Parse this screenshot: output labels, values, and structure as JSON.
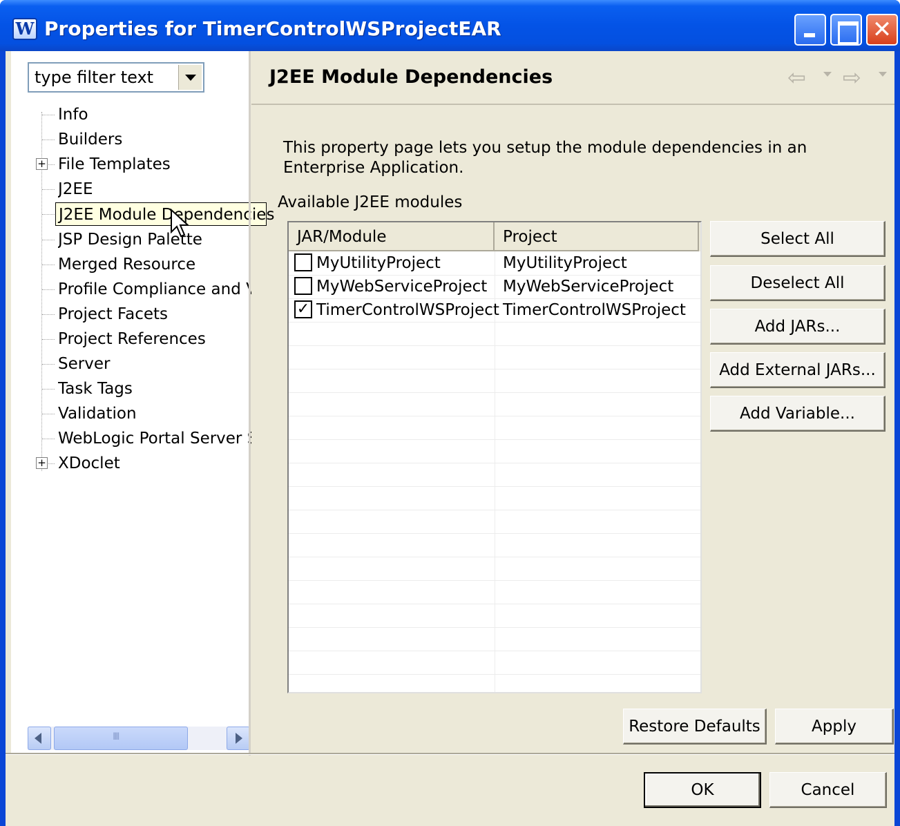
{
  "window": {
    "title": "Properties for TimerControlWSProjectEAR",
    "app_icon": "W"
  },
  "filter": {
    "placeholder": "type filter text"
  },
  "tree": {
    "items": [
      {
        "label": "Info",
        "expandable": false
      },
      {
        "label": "Builders",
        "expandable": false
      },
      {
        "label": "File Templates",
        "expandable": true
      },
      {
        "label": "J2EE",
        "expandable": false
      },
      {
        "label": "J2EE Module Dependencies",
        "expandable": false,
        "selected": true
      },
      {
        "label": "JSP Design Palette",
        "expandable": false
      },
      {
        "label": "Merged Resource",
        "expandable": false
      },
      {
        "label": "Profile Compliance and Va",
        "expandable": false
      },
      {
        "label": "Project Facets",
        "expandable": false
      },
      {
        "label": "Project References",
        "expandable": false
      },
      {
        "label": "Server",
        "expandable": false
      },
      {
        "label": "Task Tags",
        "expandable": false
      },
      {
        "label": "Validation",
        "expandable": false
      },
      {
        "label": "WebLogic Portal Server S",
        "expandable": false
      },
      {
        "label": "XDoclet",
        "expandable": true
      }
    ]
  },
  "page": {
    "title": "J2EE Module Dependencies",
    "description": "This property page lets you setup the module dependencies in an Enterprise Application.",
    "available_label": "Available J2EE modules"
  },
  "table": {
    "columns": [
      "JAR/Module",
      "Project"
    ],
    "rows": [
      {
        "checked": false,
        "module": "MyUtilityProject",
        "project": "MyUtilityProject"
      },
      {
        "checked": false,
        "module": "MyWebServiceProject",
        "project": "MyWebServiceProject"
      },
      {
        "checked": true,
        "module": "TimerControlWSProject",
        "project": "TimerControlWSProject"
      }
    ]
  },
  "side_buttons": {
    "select_all": "Select All",
    "deselect_all": "Deselect All",
    "add_jars": "Add JARs...",
    "add_external_jars": "Add External JARs...",
    "add_variable": "Add Variable..."
  },
  "page_buttons": {
    "restore_defaults": "Restore Defaults",
    "apply": "Apply"
  },
  "dialog_buttons": {
    "ok": "OK",
    "cancel": "Cancel"
  },
  "colors": {
    "titlebar": "#0453e6",
    "dialog_bg": "#ece9d8",
    "tooltip_bg": "#ffffe1"
  }
}
